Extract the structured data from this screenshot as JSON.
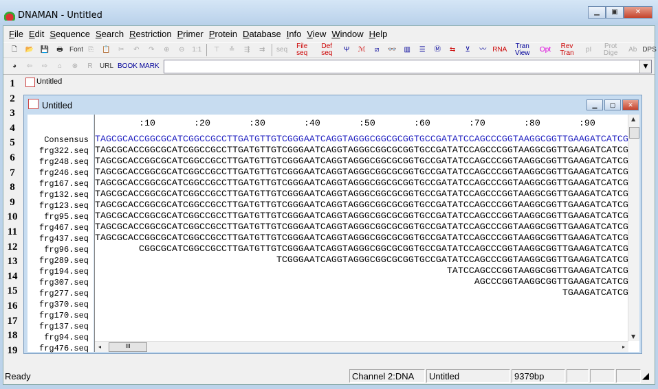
{
  "window": {
    "title": "DNAMAN - Untitled"
  },
  "menu": [
    "File",
    "Edit",
    "Sequence",
    "Search",
    "Restriction",
    "Primer",
    "Protein",
    "Database",
    "Info",
    "View",
    "Window",
    "Help"
  ],
  "toolbar1": [
    {
      "name": "new-icon",
      "glyph": "🗋"
    },
    {
      "name": "open-icon",
      "glyph": "📂"
    },
    {
      "name": "save-icon",
      "glyph": "💾"
    },
    {
      "name": "print-icon",
      "glyph": "🖶"
    },
    {
      "name": "font-button",
      "glyph": "Font"
    },
    {
      "name": "copy-icon",
      "glyph": "⎘",
      "c": "grey"
    },
    {
      "name": "paste-icon",
      "glyph": "📋",
      "c": "grey"
    },
    {
      "name": "cut-icon",
      "glyph": "✂",
      "c": "grey"
    },
    {
      "name": "undo-icon",
      "glyph": "↶",
      "c": "grey"
    },
    {
      "name": "redo-icon",
      "glyph": "↷",
      "c": "grey"
    },
    {
      "name": "zoom-in-icon",
      "glyph": "⊕",
      "c": "grey"
    },
    {
      "name": "zoom-out-icon",
      "glyph": "⊖",
      "c": "grey"
    },
    {
      "name": "zoom-reset-button",
      "glyph": "1:1",
      "c": "grey"
    },
    {
      "sep": true
    },
    {
      "name": "align-icon-1",
      "glyph": "⊤",
      "c": "grey"
    },
    {
      "name": "align-icon-2",
      "glyph": "≛",
      "c": "grey"
    },
    {
      "name": "align-icon-3",
      "glyph": "⇶",
      "c": "grey"
    },
    {
      "name": "align-icon-4",
      "glyph": "⇉",
      "c": "grey"
    },
    {
      "sep": true
    },
    {
      "name": "seq-button",
      "glyph": "seq",
      "c": "grey"
    },
    {
      "name": "file-seq-button",
      "glyph": "File seq",
      "c": "red"
    },
    {
      "name": "def-seq-button",
      "glyph": "Def seq",
      "c": "red"
    },
    {
      "name": "restriction-icon",
      "glyph": "Ψ",
      "c": "blue"
    },
    {
      "name": "restriction-map-icon",
      "glyph": "ℳ",
      "c": "red"
    },
    {
      "name": "dotplot-icon",
      "glyph": "⧄",
      "c": "blue"
    },
    {
      "name": "binoculars-icon",
      "glyph": "👓"
    },
    {
      "name": "map-icon",
      "glyph": "▥",
      "c": "blue"
    },
    {
      "name": "list-icon",
      "glyph": "☰",
      "c": "blue"
    },
    {
      "name": "m-icon",
      "glyph": "Ⓜ",
      "c": "blue"
    },
    {
      "name": "arrows-icon",
      "glyph": "⇆",
      "c": "red"
    },
    {
      "name": "insert-icon",
      "glyph": "⊻",
      "c": "blue"
    },
    {
      "name": "graph-icon",
      "glyph": "〰",
      "c": "blue"
    },
    {
      "name": "rna-button",
      "glyph": "RNA",
      "c": "red"
    },
    {
      "name": "tran-view-button",
      "glyph": "Tran View",
      "c": "blue"
    },
    {
      "name": "opt-button",
      "glyph": "Opt",
      "c": "mag"
    },
    {
      "name": "rev-tran-button",
      "glyph": "Rev Tran",
      "c": "red"
    },
    {
      "name": "pi-button",
      "glyph": "pI",
      "c": "grey"
    },
    {
      "name": "prot-dige-button",
      "glyph": "Prot Dige",
      "c": "grey"
    },
    {
      "name": "ab-button",
      "glyph": "Ab",
      "c": "grey"
    },
    {
      "name": "dps-button",
      "glyph": "DPS"
    }
  ],
  "toolbar2": [
    {
      "name": "globe-icon",
      "glyph": "◕"
    },
    {
      "name": "back-icon",
      "glyph": "⇦",
      "c": "grey"
    },
    {
      "name": "forward-icon",
      "glyph": "⇨",
      "c": "grey"
    },
    {
      "name": "home-icon",
      "glyph": "⌂",
      "c": "grey"
    },
    {
      "name": "stop-icon",
      "glyph": "⊗",
      "c": "grey"
    },
    {
      "name": "refresh-button",
      "glyph": "R",
      "c": "grey"
    },
    {
      "name": "url-button",
      "glyph": "URL"
    },
    {
      "name": "bookmark-button",
      "glyph": "BOOK MARK",
      "c": "blue"
    }
  ],
  "url_value": "",
  "gutter": [
    "1",
    "2",
    "3",
    "4",
    "5",
    "6",
    "7",
    "8",
    "9",
    "10",
    "11",
    "12",
    "13",
    "14",
    "15",
    "16",
    "17",
    "18",
    "19"
  ],
  "mdi_tab": "Untitled",
  "child": {
    "title": "Untitled"
  },
  "ruler": [
    10,
    20,
    30,
    40,
    50,
    60,
    70,
    80,
    90
  ],
  "consensus": {
    "label": "Consensus",
    "sequence": "TAGCGCACCGGCGCATCGGCCGCCTTGATGTTGTCGGGAATCAGGTAGGGCGGCGCGGTGCCGATATCCAGCCCGGTAAGGCGGTTGAAGATCATCG"
  },
  "rows": [
    {
      "name": "frg322.seq",
      "start": 1
    },
    {
      "name": "frg248.seq",
      "start": 1
    },
    {
      "name": "frg246.seq",
      "start": 1
    },
    {
      "name": "frg167.seq",
      "start": 1
    },
    {
      "name": "frg132.seq",
      "start": 1
    },
    {
      "name": "frg123.seq",
      "start": 1
    },
    {
      "name": "frg95.seq",
      "start": 1
    },
    {
      "name": "frg467.seq",
      "start": 1
    },
    {
      "name": "frg437.seq",
      "start": 1
    },
    {
      "name": "frg96.seq",
      "start": 9
    },
    {
      "name": "frg289.seq",
      "start": 34
    },
    {
      "name": "frg194.seq",
      "start": 65
    },
    {
      "name": "frg307.seq",
      "start": 70
    },
    {
      "name": "frg277.seq",
      "start": 86
    },
    {
      "name": "frg370.seq",
      "start": null
    },
    {
      "name": "frg170.seq",
      "start": null
    },
    {
      "name": "frg137.seq",
      "start": null
    },
    {
      "name": "frg94.seq",
      "start": null
    },
    {
      "name": "frg476.seq",
      "start": null
    }
  ],
  "colors": {
    "consensus": "#2020c0"
  },
  "status": {
    "ready": "Ready",
    "channel": "Channel 2:DNA",
    "doc": "Untitled",
    "length": "9379bp"
  }
}
